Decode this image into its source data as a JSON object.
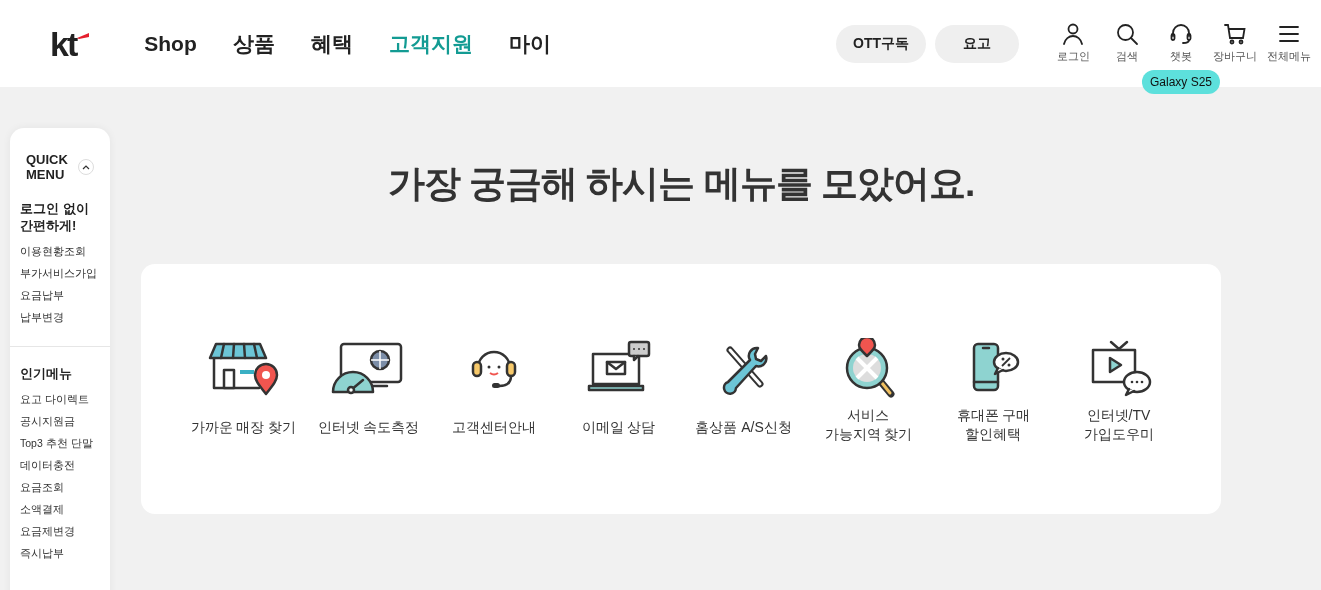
{
  "logo": "kt",
  "nav": [
    {
      "label": "Shop",
      "selected": false
    },
    {
      "label": "상품",
      "selected": false
    },
    {
      "label": "혜택",
      "selected": false
    },
    {
      "label": "고객지원",
      "selected": true
    },
    {
      "label": "마이",
      "selected": false
    }
  ],
  "pills": [
    "OTT구독",
    "요고"
  ],
  "utility": [
    {
      "kind": "person",
      "label": "로그인"
    },
    {
      "kind": "search",
      "label": "검색"
    },
    {
      "kind": "headset",
      "label": "챗봇",
      "tooltip": "Galaxy S25"
    },
    {
      "kind": "cart",
      "label": "장바구니"
    },
    {
      "kind": "menu",
      "label": "전체메뉴"
    }
  ],
  "quick_menu": {
    "title": [
      "QUICK",
      "MENU"
    ],
    "sections": [
      {
        "heading": [
          "로그인 없이",
          "간편하게!"
        ],
        "items": [
          "이용현황조회",
          "부가서비스가입",
          "요금납부",
          "납부변경"
        ]
      },
      {
        "heading": [
          "인기메뉴"
        ],
        "items": [
          "요고 다이렉트",
          "공시지원금",
          "Top3 추천 단말",
          "데이터충전",
          "요금조회",
          "소액결제",
          "요금제변경",
          "즉시납부"
        ]
      }
    ]
  },
  "headline": "가장 궁금해 하시는 메뉴를 모았어요.",
  "menus": [
    {
      "kind": "store",
      "label": [
        "가까운 매장 찾기"
      ]
    },
    {
      "kind": "speed",
      "label": [
        "인터넷 속도측정"
      ]
    },
    {
      "kind": "support",
      "label": [
        "고객센터안내"
      ]
    },
    {
      "kind": "email",
      "label": [
        "이메일 상담"
      ]
    },
    {
      "kind": "tools",
      "label": [
        "홈상품 A/S신청"
      ]
    },
    {
      "kind": "area",
      "label": [
        "서비스",
        "가능지역 찾기"
      ]
    },
    {
      "kind": "phone",
      "label": [
        "휴대폰 구매",
        "할인혜택"
      ]
    },
    {
      "kind": "tv",
      "label": [
        "인터넷/TV",
        "가입도우미"
      ]
    }
  ]
}
